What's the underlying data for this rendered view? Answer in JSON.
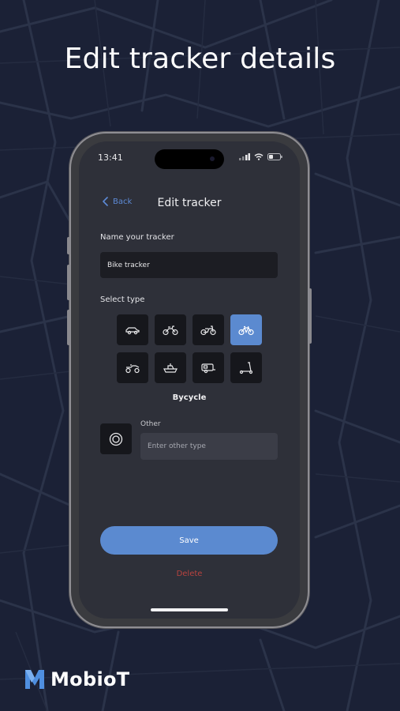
{
  "headline": "Edit tracker details",
  "status_bar": {
    "time": "13:41"
  },
  "nav": {
    "back_label": "Back",
    "title": "Edit tracker"
  },
  "name_section": {
    "label": "Name your tracker",
    "value": "Bike tracker"
  },
  "type_section": {
    "label": "Select type",
    "types": [
      {
        "icon": "car-icon",
        "selected": false
      },
      {
        "icon": "motorcycle-icon",
        "selected": false
      },
      {
        "icon": "scooter-bike-icon",
        "selected": false
      },
      {
        "icon": "bicycle-icon",
        "selected": true
      },
      {
        "icon": "atv-icon",
        "selected": false
      },
      {
        "icon": "boat-icon",
        "selected": false
      },
      {
        "icon": "caravan-icon",
        "selected": false
      },
      {
        "icon": "kick-scooter-icon",
        "selected": false
      }
    ],
    "selected_name": "Bycycle"
  },
  "other_section": {
    "label": "Other",
    "placeholder": "Enter other type",
    "icon": "target-icon"
  },
  "actions": {
    "save_label": "Save",
    "delete_label": "Delete"
  },
  "brand": {
    "name": "MobioT",
    "logo_letter": "M"
  },
  "colors": {
    "background": "#1b2136",
    "screen": "#2e3039",
    "accent": "#5b8ad0",
    "delete": "#b8433f"
  }
}
